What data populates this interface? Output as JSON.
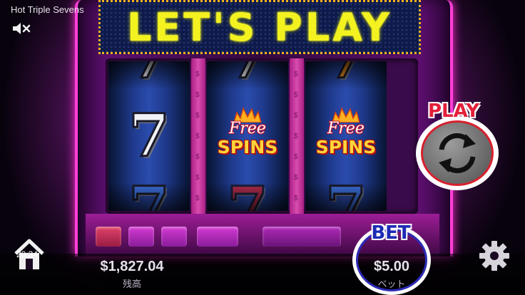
{
  "game": {
    "title": "Hot Triple Sevens",
    "marquee": "LET'S PLAY"
  },
  "reels": [
    {
      "top": "7",
      "middle": "7",
      "bottom": "7"
    },
    {
      "top": "7",
      "middle_line1": "Free",
      "middle_line2": "SPINS",
      "bottom": "7"
    },
    {
      "top": "7",
      "middle_line1": "Free",
      "middle_line2": "SPINS",
      "bottom": "7"
    }
  ],
  "controls": {
    "play_label": "PLAY",
    "bet_label": "BET",
    "bet_value": "$5.00",
    "bet_sub": "ベット",
    "balance_value": "$1,827.04",
    "balance_label": "残高",
    "clock": "20:34"
  },
  "icons": {
    "mute": "mute-icon",
    "spin": "refresh-icon",
    "home": "home-icon",
    "settings": "gear-icon"
  },
  "colors": {
    "accent_pink": "#ff3fd8",
    "marquee_text": "#f3f220",
    "play_red": "#e3203a",
    "bet_blue": "#1d2bb5"
  }
}
